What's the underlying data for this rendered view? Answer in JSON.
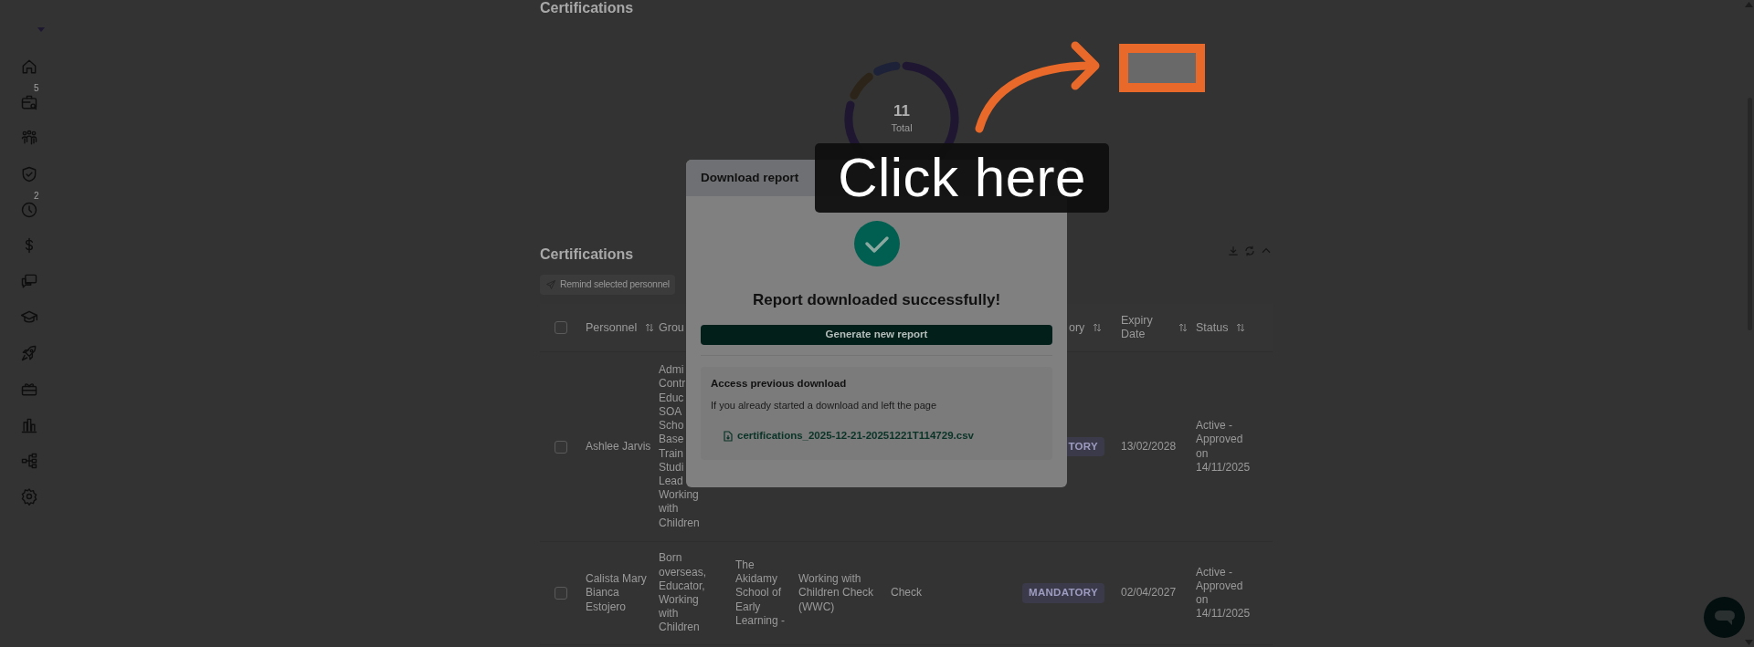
{
  "sidebar": {
    "items": [
      {
        "kind": "home"
      },
      {
        "kind": "briefcase",
        "badge": "5"
      },
      {
        "kind": "team"
      },
      {
        "kind": "shield"
      },
      {
        "kind": "clock",
        "badge": "2"
      },
      {
        "kind": "dollar"
      },
      {
        "kind": "chat"
      },
      {
        "kind": "graduation"
      },
      {
        "kind": "rocket"
      },
      {
        "kind": "gift"
      },
      {
        "kind": "chart"
      },
      {
        "kind": "hierarchy"
      },
      {
        "kind": "settings"
      }
    ]
  },
  "summary_card": {
    "title": "Certifications",
    "total": "11",
    "total_label": "Total"
  },
  "table_card": {
    "title": "Certifications",
    "remind_button": "Remind selected personnel",
    "columns": [
      {
        "kind": "checkbox",
        "checked": false
      },
      {
        "kind": "text",
        "label": "Personnel",
        "sortable": true
      },
      {
        "kind": "text",
        "label": "Grou"
      },
      {
        "kind": "text"
      },
      {
        "kind": "text"
      },
      {
        "kind": "text"
      },
      {
        "kind": "badge",
        "label": "ory",
        "sortable": true
      },
      {
        "kind": "text",
        "label": "Expiry Date",
        "sortable": true
      },
      {
        "kind": "text",
        "label": "Status",
        "sortable": true
      }
    ],
    "rows": [
      {
        "checked": false,
        "personnel": "Ashlee Jarvis",
        "group": [
          "Admi",
          "Contr",
          "Educ",
          "SOA",
          "Scho",
          "Base",
          "Train",
          "Studi",
          "Lead",
          "Working",
          "with",
          "Children"
        ],
        "category": "TORY",
        "expiry": "13/02/2028",
        "status": "Active - Approved on 14/11/2025"
      },
      {
        "checked": false,
        "personnel": "Calista Mary Bianca Estojero",
        "group": [
          "Born",
          "overseas,",
          "Educator,",
          "Working",
          "with",
          "Children"
        ],
        "column_3": "The Akidamy School of Early Learning -",
        "column_4": "Working with Children Check (WWC)",
        "column_5": "Check",
        "category": "MANDATORY",
        "expiry": "02/04/2027",
        "status": "Active - Approved on 14/11/2025"
      }
    ]
  },
  "modal": {
    "title": "Download report",
    "message": "Report downloaded successfully!",
    "primary_button": "Generate new report",
    "previous": {
      "title": "Access previous download",
      "description": "If you already started a download and left the page",
      "file": "certifications_2025-12-21-20251221T114729.csv"
    }
  },
  "callout": {
    "label": "Click here"
  }
}
